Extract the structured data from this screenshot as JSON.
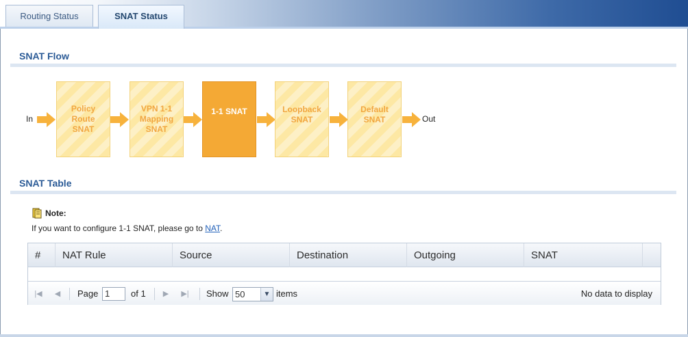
{
  "tabs": [
    {
      "label": "Routing Status",
      "active": false
    },
    {
      "label": "SNAT Status",
      "active": true
    }
  ],
  "snat_flow": {
    "title": "SNAT Flow",
    "in_label": "In",
    "out_label": "Out",
    "steps": [
      {
        "label": "Policy Route SNAT",
        "active": false
      },
      {
        "label": "VPN 1-1 Mapping SNAT",
        "active": false
      },
      {
        "label": "1-1 SNAT",
        "active": true
      },
      {
        "label": "Loopback SNAT",
        "active": false
      },
      {
        "label": "Default SNAT",
        "active": false
      }
    ]
  },
  "snat_table": {
    "title": "SNAT Table",
    "note_title": "Note:",
    "note_text": "If you want to configure 1-1 SNAT, please go to ",
    "note_link": "NAT",
    "note_suffix": ".",
    "columns": [
      "#",
      "NAT Rule",
      "Source",
      "Destination",
      "Outgoing",
      "SNAT"
    ],
    "rows": [],
    "pager": {
      "page_label": "Page",
      "page_value": "1",
      "of_label": "of 1",
      "show_label": "Show",
      "show_value": "50",
      "items_label": "items",
      "empty_message": "No data to display"
    }
  },
  "colors": {
    "accent": "#2a5a96",
    "active_step": "#f4a935",
    "step_text": "#f1a640",
    "link": "#1f5fb8"
  }
}
